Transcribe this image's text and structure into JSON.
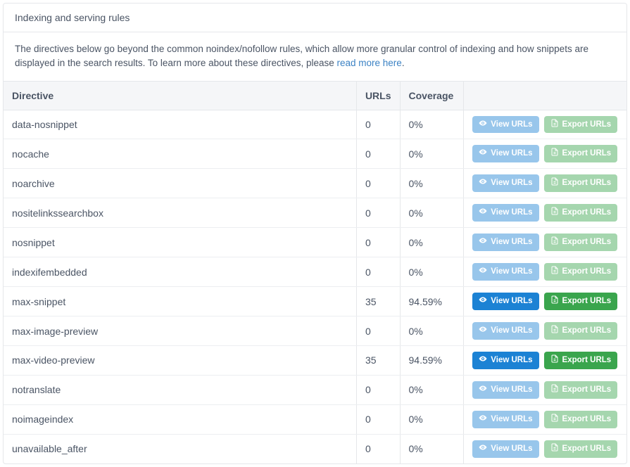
{
  "header": {
    "title": "Indexing and serving rules"
  },
  "desc": {
    "text_before": "The directives below go beyond the common noindex/nofollow rules, which allow more granular control of indexing and how snippets are displayed in the search results. To learn more about these directives, please ",
    "link_text": "read more here",
    "text_after": "."
  },
  "columns": {
    "directive": "Directive",
    "urls": "URLs",
    "coverage": "Coverage",
    "actions": ""
  },
  "buttons": {
    "view": "View URLs",
    "export": "Export URLs"
  },
  "rows": [
    {
      "directive": "data-nosnippet",
      "urls": "0",
      "coverage": "0%",
      "active": false
    },
    {
      "directive": "nocache",
      "urls": "0",
      "coverage": "0%",
      "active": false
    },
    {
      "directive": "noarchive",
      "urls": "0",
      "coverage": "0%",
      "active": false
    },
    {
      "directive": "nositelinkssearchbox",
      "urls": "0",
      "coverage": "0%",
      "active": false
    },
    {
      "directive": "nosnippet",
      "urls": "0",
      "coverage": "0%",
      "active": false
    },
    {
      "directive": "indexifembedded",
      "urls": "0",
      "coverage": "0%",
      "active": false
    },
    {
      "directive": "max-snippet",
      "urls": "35",
      "coverage": "94.59%",
      "active": true
    },
    {
      "directive": "max-image-preview",
      "urls": "0",
      "coverage": "0%",
      "active": false
    },
    {
      "directive": "max-video-preview",
      "urls": "35",
      "coverage": "94.59%",
      "active": true
    },
    {
      "directive": "notranslate",
      "urls": "0",
      "coverage": "0%",
      "active": false
    },
    {
      "directive": "noimageindex",
      "urls": "0",
      "coverage": "0%",
      "active": false
    },
    {
      "directive": "unavailable_after",
      "urls": "0",
      "coverage": "0%",
      "active": false
    }
  ]
}
